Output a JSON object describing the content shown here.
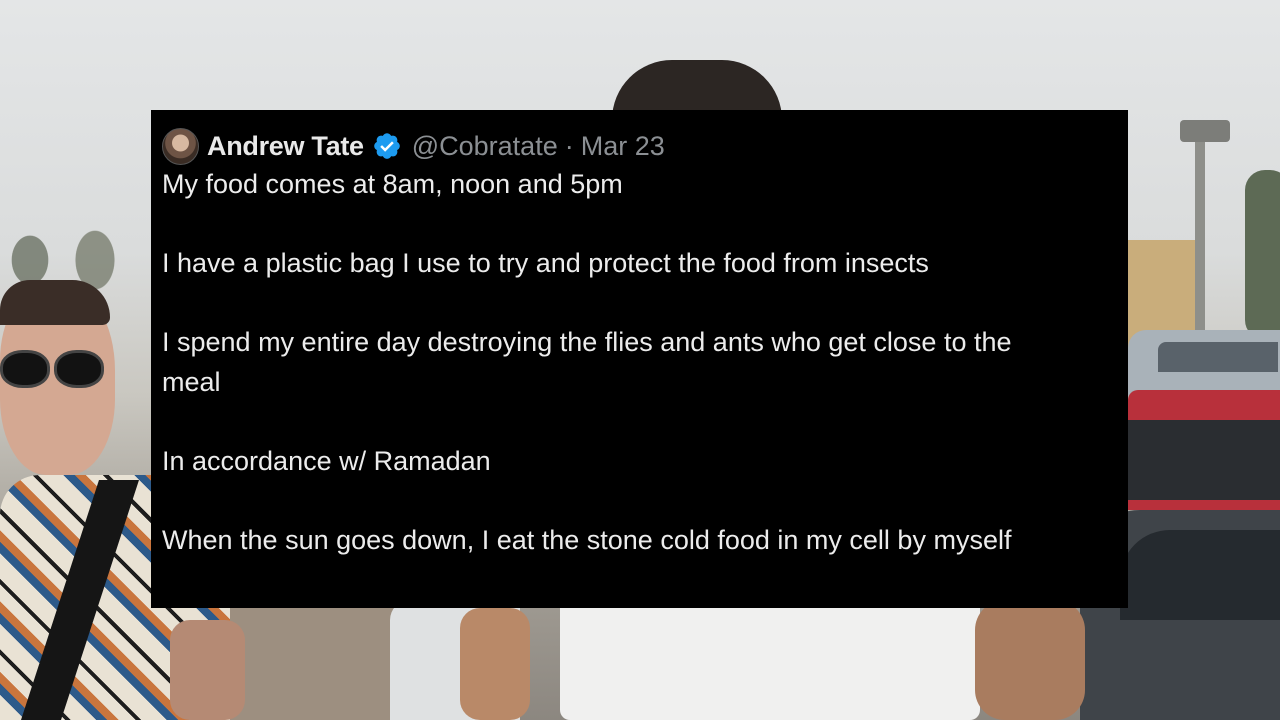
{
  "tweet": {
    "author_name": "Andrew Tate",
    "verified_icon": "verified-badge-icon",
    "handle": "@Cobratate",
    "separator": "·",
    "date": "Mar 23",
    "paragraphs": [
      "My food comes at 8am, noon and 5pm",
      "I have a plastic bag I use to try and protect the food from insects",
      "I spend my entire day destroying the flies and ants who get close to the meal",
      "In accordance w/ Ramadan",
      "When the sun goes down, I eat the stone cold food in my cell by myself"
    ]
  },
  "colors": {
    "card_background": "#000000",
    "name_text": "#e9e9e9",
    "meta_text": "#8b8f93",
    "verified_blue": "#1d9bf0"
  }
}
